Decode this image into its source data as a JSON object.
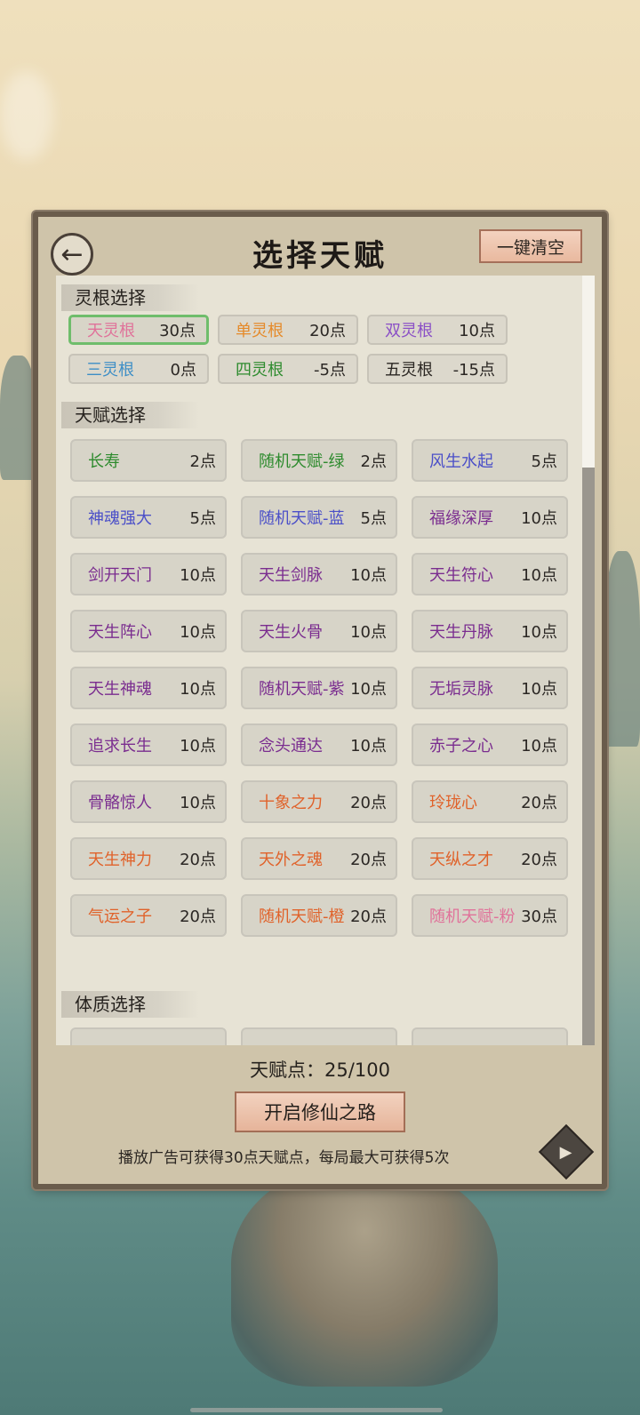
{
  "header": {
    "title": "选择天赋",
    "clear_label": "一键清空"
  },
  "root_section": {
    "title": "灵根选择",
    "items": [
      {
        "name": "天灵根",
        "points": "30点",
        "color": "#e0729a",
        "selected": true
      },
      {
        "name": "单灵根",
        "points": "20点",
        "color": "#e58a2a",
        "selected": false
      },
      {
        "name": "双灵根",
        "points": "10点",
        "color": "#8a4fc6",
        "selected": false
      },
      {
        "name": "三灵根",
        "points": "0点",
        "color": "#3d8ec6",
        "selected": false
      },
      {
        "name": "四灵根",
        "points": "-5点",
        "color": "#2e8b2e",
        "selected": false
      },
      {
        "name": "五灵根",
        "points": "-15点",
        "color": "#2a2622",
        "selected": false
      }
    ]
  },
  "talent_section": {
    "title": "天赋选择",
    "items": [
      {
        "name": "长寿",
        "points": "2点"
      },
      {
        "name": "随机天赋-绿",
        "points": "2点"
      },
      {
        "name": "风生水起",
        "points": "5点"
      },
      {
        "name": "神魂强大",
        "points": "5点"
      },
      {
        "name": "随机天赋-蓝",
        "points": "5点"
      },
      {
        "name": "福缘深厚",
        "points": "10点"
      },
      {
        "name": "剑开天门",
        "points": "10点"
      },
      {
        "name": "天生剑脉",
        "points": "10点"
      },
      {
        "name": "天生符心",
        "points": "10点"
      },
      {
        "name": "天生阵心",
        "points": "10点"
      },
      {
        "name": "天生火骨",
        "points": "10点"
      },
      {
        "name": "天生丹脉",
        "points": "10点"
      },
      {
        "name": "天生神魂",
        "points": "10点"
      },
      {
        "name": "随机天赋-紫",
        "points": "10点"
      },
      {
        "name": "无垢灵脉",
        "points": "10点"
      },
      {
        "name": "追求长生",
        "points": "10点"
      },
      {
        "name": "念头通达",
        "points": "10点"
      },
      {
        "name": "赤子之心",
        "points": "10点"
      },
      {
        "name": "骨骼惊人",
        "points": "10点"
      },
      {
        "name": "十象之力",
        "points": "20点"
      },
      {
        "name": "玲珑心",
        "points": "20点"
      },
      {
        "name": "天生神力",
        "points": "20点"
      },
      {
        "name": "天外之魂",
        "points": "20点"
      },
      {
        "name": "天纵之才",
        "points": "20点"
      },
      {
        "name": "气运之子",
        "points": "20点"
      },
      {
        "name": "随机天赋-橙",
        "points": "20点"
      },
      {
        "name": "随机天赋-粉",
        "points": "30点"
      }
    ]
  },
  "physique_section": {
    "title": "体质选择"
  },
  "footer": {
    "points_label": "天赋点：",
    "points_value": "25/100",
    "start_label": "开启修仙之路",
    "ad_text": "播放广告可获得30点天赋点，每局最大可获得5次"
  },
  "colors": {
    "green": "#2e8b2e",
    "indigo": "#4b4fc8",
    "violet": "#7a2c8f",
    "orange_red": "#e0622a",
    "pink": "#e0729a",
    "selected_border": "#6fbd6b"
  }
}
